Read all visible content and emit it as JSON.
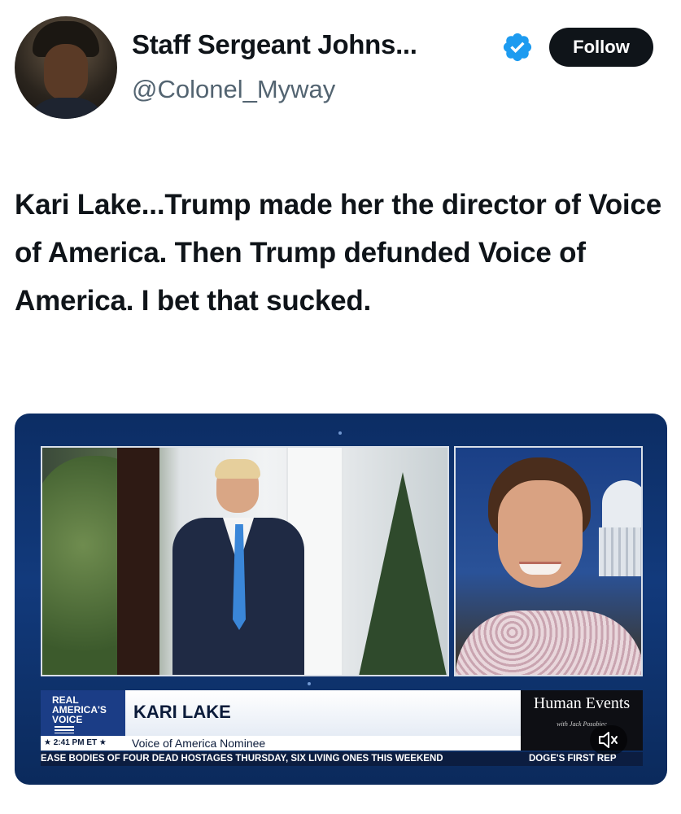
{
  "author": {
    "display_name": "Staff Sergeant Johns...",
    "handle": "@Colonel_Myway",
    "verified": true,
    "avatar_icon": "profile-photo"
  },
  "actions": {
    "follow_label": "Follow"
  },
  "tweet": {
    "text": "Kari Lake...Trump made her the director of Voice of America. Then Trump defunded Voice of America. I bet that sucked."
  },
  "media": {
    "type": "video",
    "lower_third": {
      "network_logo": "REAL AMERICA'S VOICE",
      "time": "2:41 PM ET",
      "guest_name": "KARI LAKE",
      "guest_title": "Voice of America Nominee",
      "show_name": "Human Events",
      "show_host": "with Jack Posobiec",
      "ticker_left": "EASE BODIES OF FOUR DEAD HOSTAGES THURSDAY, SIX LIVING ONES THIS WEEKEND",
      "ticker_right": "DOGE'S FIRST REP"
    },
    "mute_icon": "speaker-muted-icon"
  },
  "colors": {
    "text_primary": "#0f1419",
    "text_secondary": "#536471",
    "verified_badge": "#1d9bf0",
    "follow_button": "#0f1419"
  }
}
